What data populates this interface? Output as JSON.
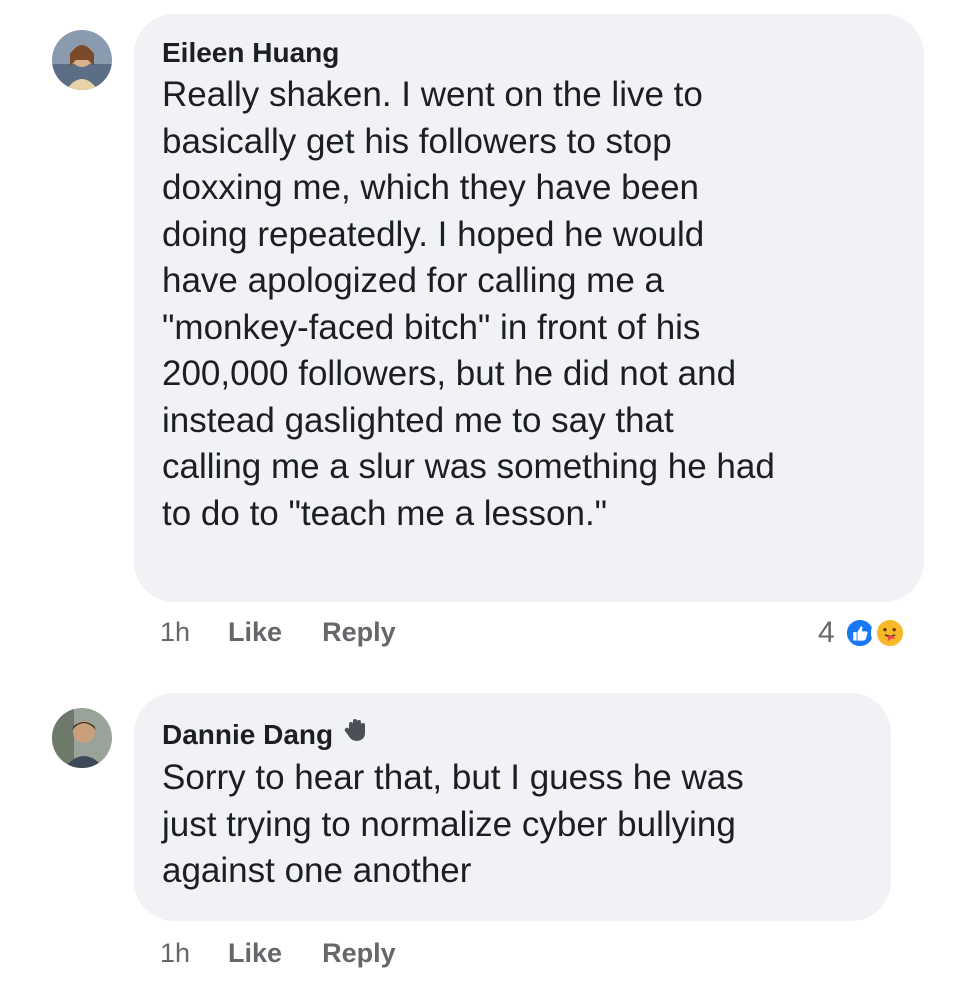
{
  "comments": [
    {
      "author": "Eileen Huang",
      "avatar_icon": "avatar-photo",
      "text_lines": [
        "Really shaken. I went on the live to",
        "basically get his followers to stop",
        "doxxing me, which they have been",
        "doing repeatedly. I hoped he would",
        "have apologized for calling me a",
        "\"monkey-faced bitch\" in front of his",
        "200,000 followers, but he did not and",
        "instead gaslighted me to say that",
        "calling me a slur was something he had",
        "to do to \"teach me a lesson.\""
      ],
      "time": "1h",
      "like_label": "Like",
      "reply_label": "Reply",
      "reaction_count": "4",
      "reaction_icons": [
        "like-reaction-icon",
        "care-reaction-icon"
      ]
    },
    {
      "author": "Dannie Dang",
      "avatar_icon": "avatar-photo",
      "badge_icon": "raised-hand-icon",
      "text_lines": [
        "Sorry to hear that, but I guess he was",
        "just trying to normalize cyber bullying",
        "against one another"
      ],
      "time": "1h",
      "like_label": "Like",
      "reply_label": "Reply"
    }
  ],
  "colors": {
    "bubble": "#f0f2f5",
    "meta_text": "#65676b",
    "like_blue": "#1877f2",
    "care_yellow": "#f7b928"
  }
}
